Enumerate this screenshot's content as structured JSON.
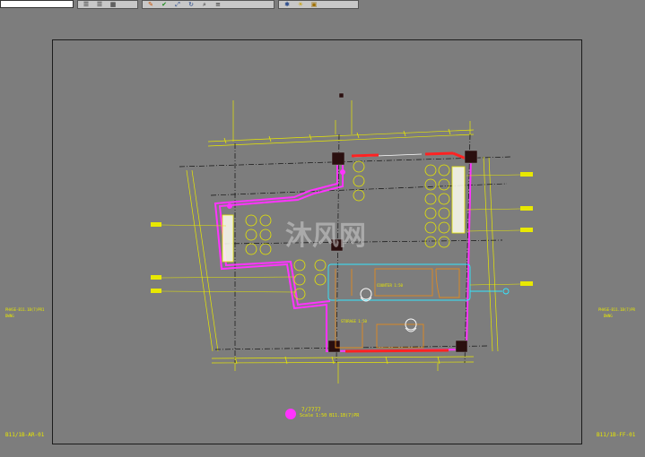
{
  "toolbar": {
    "groups": [
      {
        "icons": [
          "align-left-icon",
          "align-right-icon",
          "table-icon"
        ]
      },
      {
        "icons": [
          "paint-icon",
          "check-icon",
          "move-icon",
          "rotate-icon",
          "search-icon",
          "list-icon"
        ]
      },
      {
        "icons": [
          "gear-icon",
          "light-icon",
          "lock-icon"
        ]
      }
    ]
  },
  "drawing": {
    "left_note_1": "PHASE-B11.1B(7)PR1",
    "left_note_2": "DWNG",
    "right_note_1": "PHASE-B11.1B(7)PR",
    "right_note_2": "DWNG",
    "sheet_left": "B11/1B-AR-01",
    "sheet_right": "B11/1B-FF-01",
    "title_mark": "7/7777",
    "title_scale": "Scale 1:50 B11.1B(7)PR",
    "watermark": "沐风网",
    "counter_label": "COUNTER 1:50",
    "room_label": "STORAGE 1:50",
    "colors": {
      "wall": "#ff33ff",
      "dim": "#f0f000",
      "axis": "#101010",
      "accent_cyan": "#33e5ff",
      "accent_orange": "#e08a20",
      "accent_red": "#ff2222"
    }
  }
}
